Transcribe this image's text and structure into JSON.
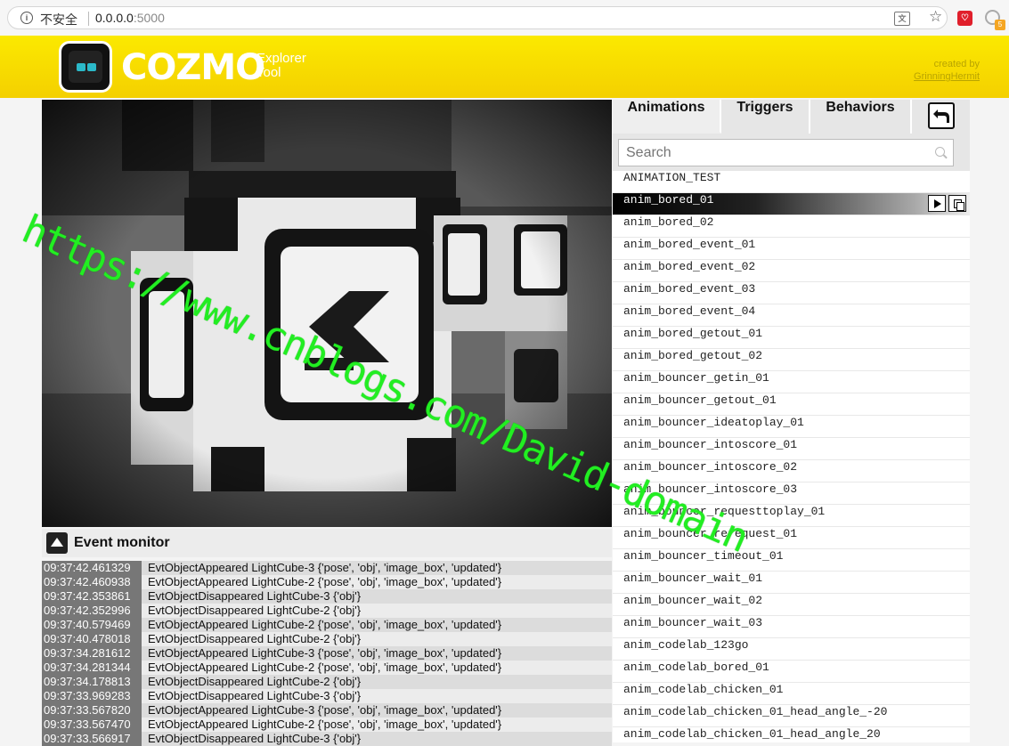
{
  "browser": {
    "security_label": "不安全",
    "url_host": "0.0.0.0",
    "url_port": ":5000",
    "ext_badge": "5"
  },
  "header": {
    "brand": "COZMO",
    "product_line1": "Explorer",
    "product_line2": "Tool",
    "credit_prefix": "created by",
    "credit_author": "GrinningHermit"
  },
  "sidebar": {
    "tabs": [
      "Animations",
      "Triggers",
      "Behaviors"
    ],
    "search_placeholder": "Search",
    "animations": [
      "ANIMATION_TEST",
      "anim_bored_01",
      "anim_bored_02",
      "anim_bored_event_01",
      "anim_bored_event_02",
      "anim_bored_event_03",
      "anim_bored_event_04",
      "anim_bored_getout_01",
      "anim_bored_getout_02",
      "anim_bouncer_getin_01",
      "anim_bouncer_getout_01",
      "anim_bouncer_ideatoplay_01",
      "anim_bouncer_intoscore_01",
      "anim_bouncer_intoscore_02",
      "anim_bouncer_intoscore_03",
      "anim_bouncer_requesttoplay_01",
      "anim_bouncer_rerequest_01",
      "anim_bouncer_timeout_01",
      "anim_bouncer_wait_01",
      "anim_bouncer_wait_02",
      "anim_bouncer_wait_03",
      "anim_codelab_123go",
      "anim_codelab_bored_01",
      "anim_codelab_chicken_01",
      "anim_codelab_chicken_01_head_angle_-20",
      "anim_codelab_chicken_01_head_angle_20"
    ],
    "selected_index": 1
  },
  "event_monitor": {
    "title": "Event monitor",
    "events": [
      {
        "time": "09:37:42.461329",
        "text": "EvtObjectAppeared LightCube-3 {'pose', 'obj', 'image_box', 'updated'}"
      },
      {
        "time": "09:37:42.460938",
        "text": "EvtObjectAppeared LightCube-2 {'pose', 'obj', 'image_box', 'updated'}"
      },
      {
        "time": "09:37:42.353861",
        "text": "EvtObjectDisappeared LightCube-3 {'obj'}"
      },
      {
        "time": "09:37:42.352996",
        "text": "EvtObjectDisappeared LightCube-2 {'obj'}"
      },
      {
        "time": "09:37:40.579469",
        "text": "EvtObjectAppeared LightCube-2 {'pose', 'obj', 'image_box', 'updated'}"
      },
      {
        "time": "09:37:40.478018",
        "text": "EvtObjectDisappeared LightCube-2 {'obj'}"
      },
      {
        "time": "09:37:34.281612",
        "text": "EvtObjectAppeared LightCube-3 {'pose', 'obj', 'image_box', 'updated'}"
      },
      {
        "time": "09:37:34.281344",
        "text": "EvtObjectAppeared LightCube-2 {'pose', 'obj', 'image_box', 'updated'}"
      },
      {
        "time": "09:37:34.178813",
        "text": "EvtObjectDisappeared LightCube-2 {'obj'}"
      },
      {
        "time": "09:37:33.969283",
        "text": "EvtObjectDisappeared LightCube-3 {'obj'}"
      },
      {
        "time": "09:37:33.567820",
        "text": "EvtObjectAppeared LightCube-3 {'pose', 'obj', 'image_box', 'updated'}"
      },
      {
        "time": "09:37:33.567470",
        "text": "EvtObjectAppeared LightCube-2 {'pose', 'obj', 'image_box', 'updated'}"
      },
      {
        "time": "09:37:33.566917",
        "text": "EvtObjectDisappeared LightCube-3 {'obj'}"
      }
    ]
  },
  "watermark": "https://www.cnblogs.com/David-domain",
  "colors": {
    "header_yellow": "#f7dc00",
    "watermark_green": "#22ee22",
    "timestamp_bg": "#777777"
  }
}
